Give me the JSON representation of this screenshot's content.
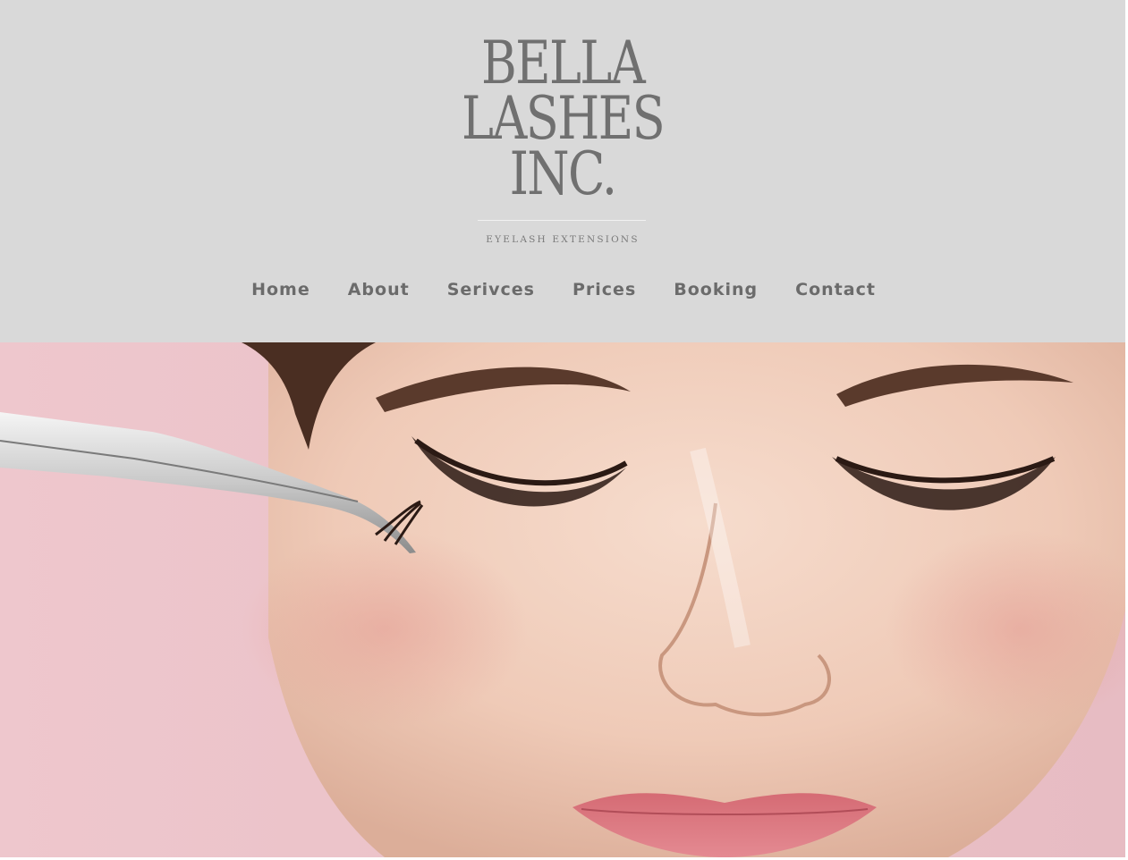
{
  "brand": {
    "logo_lines": [
      "BELLA",
      "LASHES",
      "INC."
    ],
    "tagline": "EYELASH EXTENSIONS"
  },
  "nav": {
    "items": [
      {
        "label": "Home"
      },
      {
        "label": "About"
      },
      {
        "label": "Serivces"
      },
      {
        "label": "Prices"
      },
      {
        "label": "Booking"
      },
      {
        "label": "Contact"
      }
    ]
  },
  "hero": {
    "image": "woman-face-eyelash-extension-with-tweezers"
  },
  "colors": {
    "header_bg": "#d9d9d9",
    "logo_text": "#707070",
    "nav_text": "#6b6b6b",
    "hero_bg": "#ecc5cb"
  }
}
